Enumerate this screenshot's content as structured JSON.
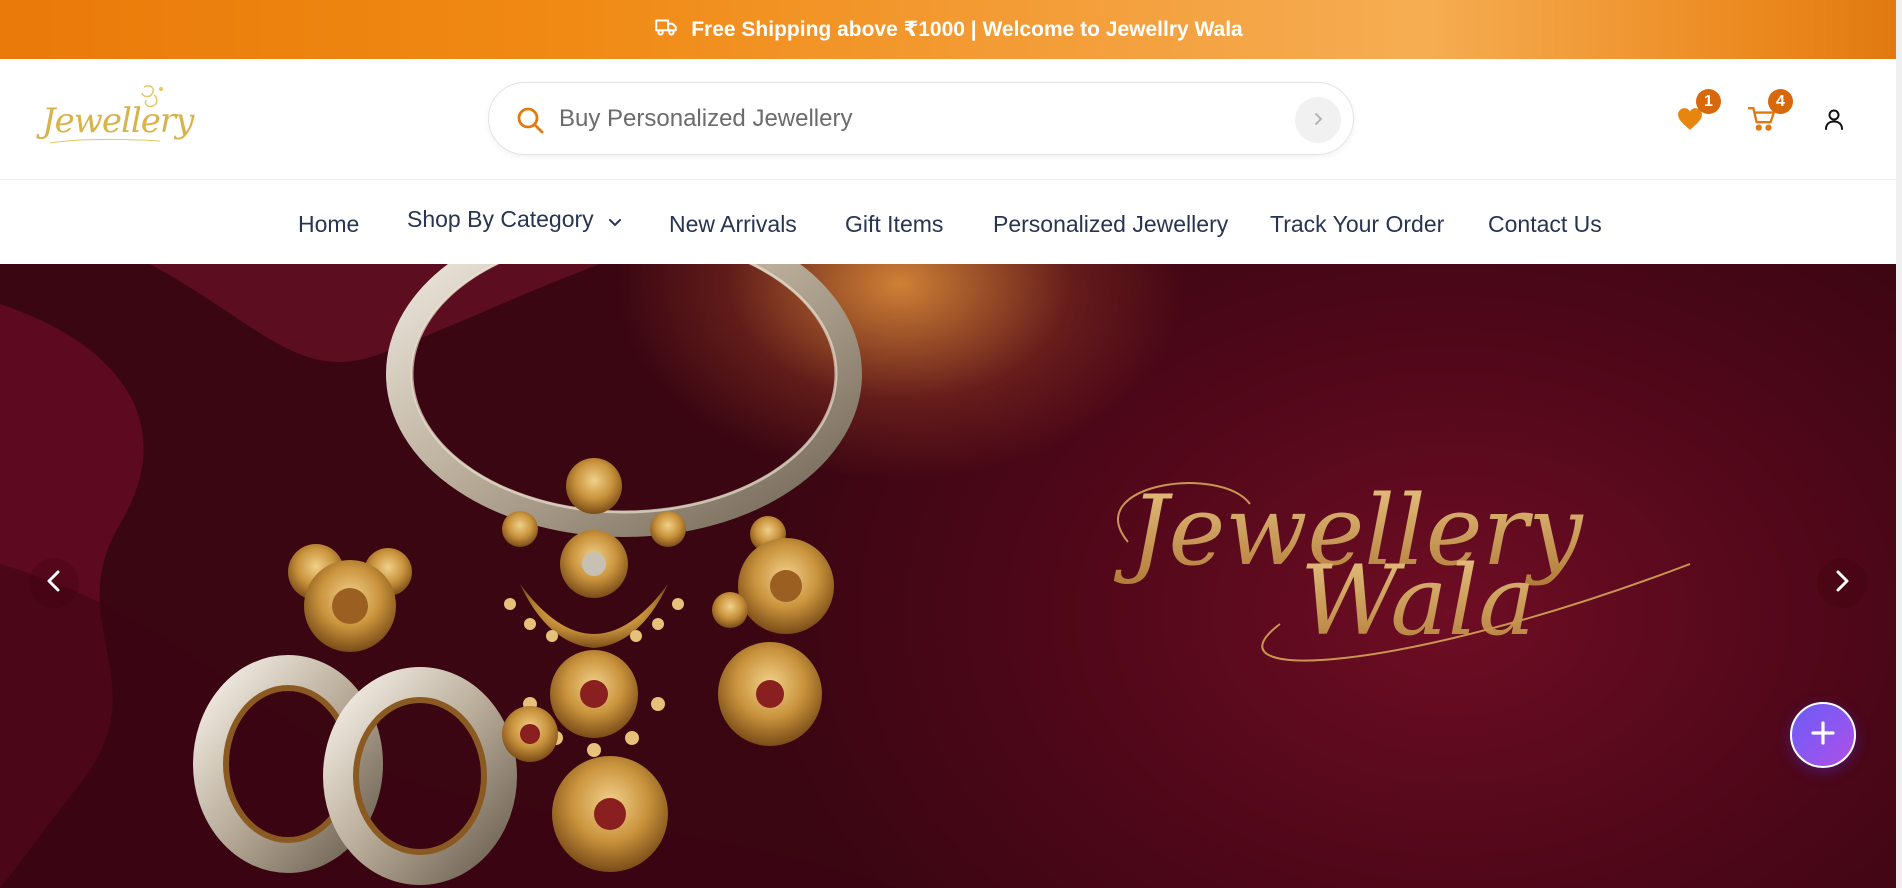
{
  "announcement": {
    "text": "Free Shipping above ₹1000 | Welcome to Jewellry Wala",
    "icon": "delivery-truck-icon"
  },
  "header": {
    "logo_text": "Jewellery",
    "search": {
      "placeholder": "Buy Personalized Jewellery",
      "value": ""
    },
    "wishlist_count": "1",
    "cart_count": "4"
  },
  "nav": {
    "items": [
      {
        "label": "Home"
      },
      {
        "label": "Shop By Category"
      },
      {
        "label": "New Arrivals"
      },
      {
        "label": "Gift Items"
      },
      {
        "label": "Personalized Jewellery"
      },
      {
        "label": "Track Your Order"
      },
      {
        "label": "Contact Us"
      }
    ]
  },
  "hero": {
    "brand_line1": "Jewellery",
    "brand_line2": "Wala"
  },
  "colors": {
    "accent": "#ea7a0a",
    "badge": "#d7680c",
    "nav_text": "#273452",
    "hero_bg": "#5a0a20",
    "fab": "#7c59f2"
  }
}
